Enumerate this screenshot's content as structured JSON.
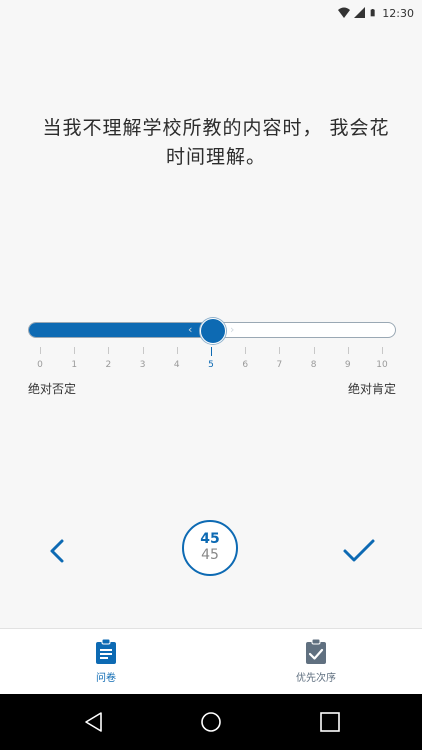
{
  "status_bar": {
    "time": "12:30"
  },
  "question": {
    "text": "当我不理解学校所教的内容时， 我会花时间理解。"
  },
  "slider": {
    "min": 0,
    "max": 10,
    "value": 5,
    "ticks": [
      "0",
      "1",
      "2",
      "3",
      "4",
      "5",
      "6",
      "7",
      "8",
      "9",
      "10"
    ],
    "min_label": "绝对否定",
    "max_label": "绝对肯定",
    "accent": "#0d6ab3"
  },
  "navigation": {
    "back_icon": "chevron-left-icon",
    "done_icon": "checkmark-icon",
    "current": "45",
    "total": "45"
  },
  "tabs": [
    {
      "label": "问卷",
      "icon": "clipboard-list-icon",
      "active": true
    },
    {
      "label": "优先次序",
      "icon": "clipboard-check-icon",
      "active": false
    }
  ],
  "colors": {
    "primary": "#0d6ab3",
    "inactive": "#607080",
    "background": "#f7f7f7"
  }
}
